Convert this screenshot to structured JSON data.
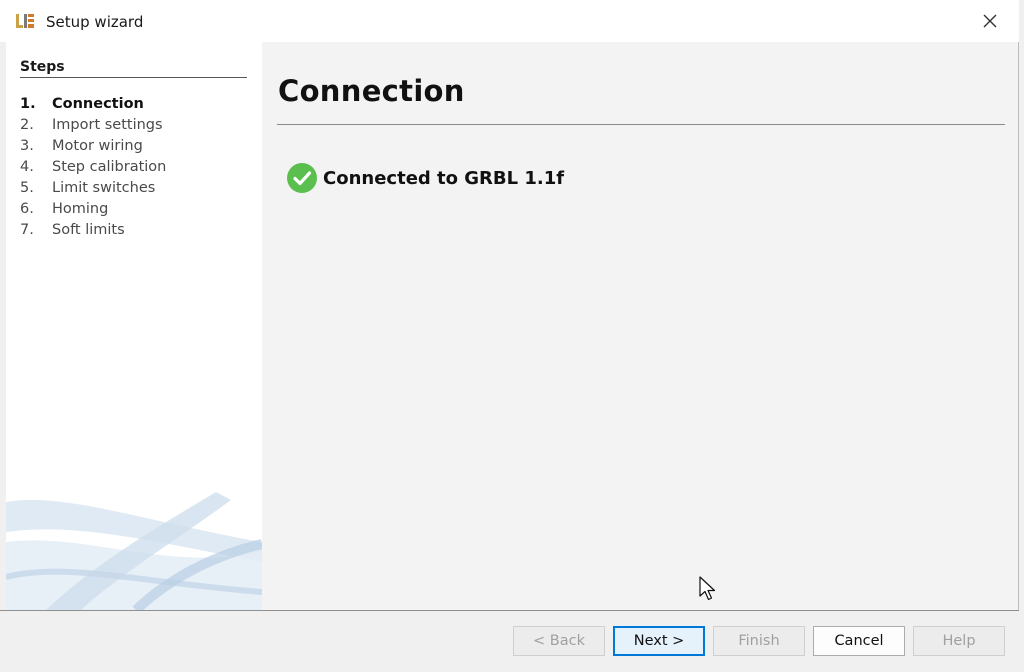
{
  "window": {
    "title": "Setup wizard",
    "icon": "lightburn-logo-icon"
  },
  "sidebar": {
    "heading": "Steps",
    "steps": [
      {
        "num": "1.",
        "label": "Connection",
        "active": true
      },
      {
        "num": "2.",
        "label": "Import settings"
      },
      {
        "num": "3.",
        "label": "Motor wiring"
      },
      {
        "num": "4.",
        "label": "Step calibration"
      },
      {
        "num": "5.",
        "label": "Limit switches"
      },
      {
        "num": "6.",
        "label": "Homing"
      },
      {
        "num": "7.",
        "label": "Soft limits"
      }
    ]
  },
  "main": {
    "title": "Connection",
    "status": {
      "icon": "check-circle-icon",
      "text": "Connected to GRBL 1.1f",
      "color": "#5bbf4f"
    }
  },
  "buttons": {
    "back": "< Back",
    "next": "Next >",
    "finish": "Finish",
    "cancel": "Cancel",
    "help": "Help"
  },
  "colors": {
    "default_button_border": "#0078d7",
    "sidebar_bg": "#ffffff",
    "content_bg": "#f3f3f3"
  }
}
